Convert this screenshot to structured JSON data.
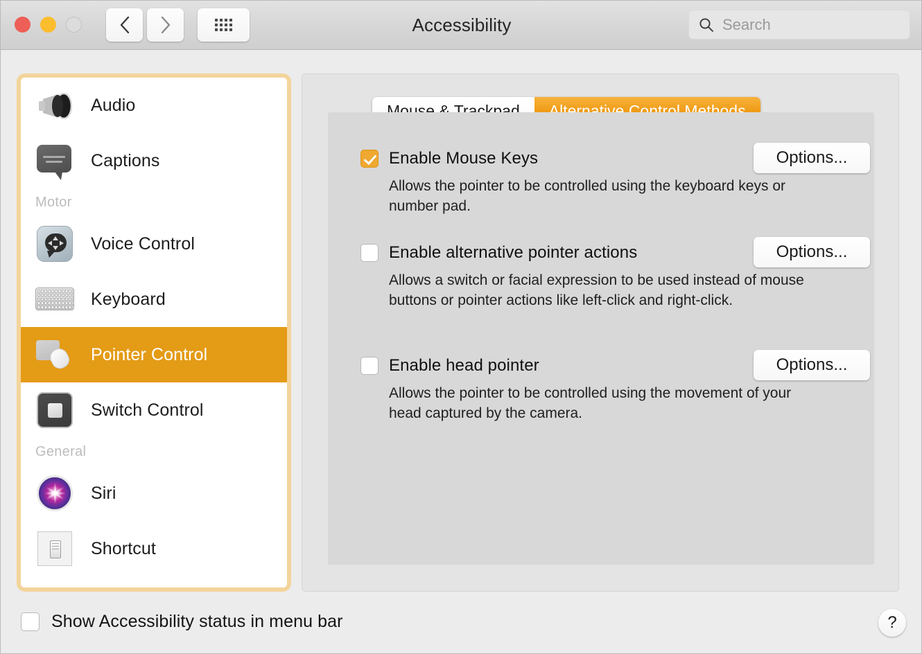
{
  "window": {
    "title": "Accessibility",
    "traffic_lights": [
      {
        "name": "close",
        "color": "#ED5F57"
      },
      {
        "name": "minimize",
        "color": "#FBBD2E"
      },
      {
        "name": "zoom",
        "color": "#DCDCDC"
      }
    ],
    "toolbar": {
      "back_icon": "chevron-left-icon",
      "forward_icon": "chevron-right-icon",
      "grid_icon": "show-all-grid-icon"
    },
    "search": {
      "placeholder": "Search",
      "icon": "search-icon",
      "value": ""
    }
  },
  "sidebar": {
    "items": [
      {
        "type": "item",
        "label": "Audio",
        "icon": "speaker-icon",
        "selected": false
      },
      {
        "type": "item",
        "label": "Captions",
        "icon": "caption-bubble-icon",
        "selected": false
      },
      {
        "type": "group",
        "label": "Motor"
      },
      {
        "type": "item",
        "label": "Voice Control",
        "icon": "voice-control-icon",
        "selected": false
      },
      {
        "type": "item",
        "label": "Keyboard",
        "icon": "keyboard-icon",
        "selected": false
      },
      {
        "type": "item",
        "label": "Pointer Control",
        "icon": "pointer-control-icon",
        "selected": true
      },
      {
        "type": "item",
        "label": "Switch Control",
        "icon": "switch-control-icon",
        "selected": false
      },
      {
        "type": "group",
        "label": "General"
      },
      {
        "type": "item",
        "label": "Siri",
        "icon": "siri-icon",
        "selected": false
      },
      {
        "type": "item",
        "label": "Shortcut",
        "icon": "shortcut-icon",
        "selected": false
      }
    ],
    "selection_color": "#E49B16",
    "focus_ring_color": "#F3D49B"
  },
  "main": {
    "tabs": [
      {
        "label": "Mouse & Trackpad",
        "active": false
      },
      {
        "label": "Alternative Control Methods",
        "active": true
      }
    ],
    "tab_active_color": "#EE9A12",
    "options": [
      {
        "title": "Enable Mouse Keys",
        "checked": true,
        "description": "Allows the pointer to be controlled using the keyboard keys or number pad.",
        "button": "Options..."
      },
      {
        "title": "Enable alternative pointer actions",
        "checked": false,
        "description": "Allows a switch or facial expression to be used instead of mouse buttons or pointer actions like left-click and right-click.",
        "button": "Options..."
      },
      {
        "title": "Enable head pointer",
        "checked": false,
        "description": "Allows the pointer to be controlled using the movement of your head captured by the camera.",
        "button": "Options..."
      }
    ]
  },
  "footer": {
    "show_status_label": "Show Accessibility status in menu bar",
    "show_status_checked": false,
    "help_label": "?",
    "help_icon": "help-question-icon"
  }
}
